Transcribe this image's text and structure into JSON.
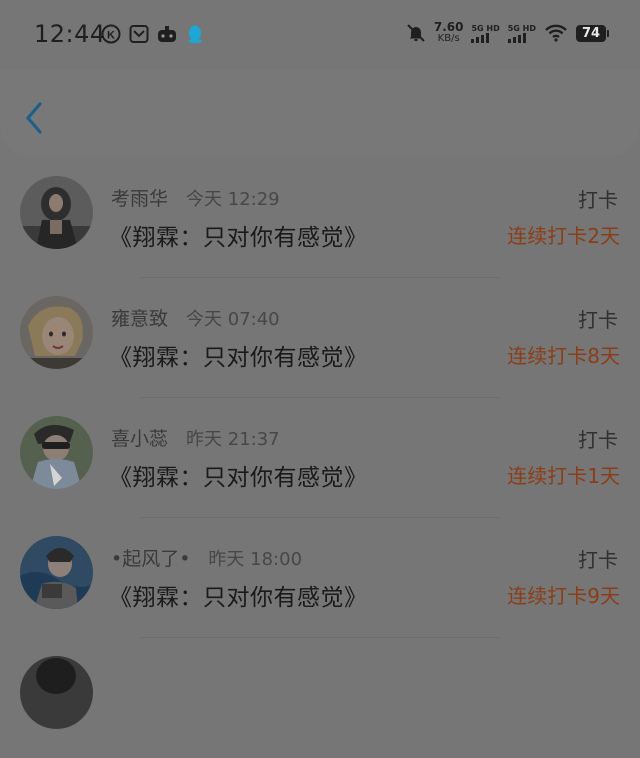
{
  "status_bar": {
    "time": "12:44",
    "left_icons": [
      "k-circle-icon",
      "app-badge-icon",
      "game-icon",
      "qq-penguin-icon"
    ],
    "net_speed": "7.60",
    "net_unit": "KB/s",
    "signal_1_label": "5G HD",
    "signal_2_label": "5G HD",
    "battery": "74",
    "icons": [
      "mute-bell-icon",
      "signal-icon",
      "signal-icon",
      "wifi-icon",
      "battery-icon"
    ]
  },
  "nav": {
    "back_icon": "chevron-left-icon"
  },
  "colors": {
    "accent": "#1e5f8a",
    "streak": "#8a3d18",
    "overlay": "#767676"
  },
  "checkins": [
    {
      "user": "考雨华",
      "time": "今天 12:29",
      "song": "《翔霖：只对你有感觉》",
      "tag": "打卡",
      "streak": "连续打卡2天"
    },
    {
      "user": "雍意致",
      "time": "今天 07:40",
      "song": "《翔霖：只对你有感觉》",
      "tag": "打卡",
      "streak": "连续打卡8天"
    },
    {
      "user": "喜小蕊",
      "time": "昨天 21:37",
      "song": "《翔霖：只对你有感觉》",
      "tag": "打卡",
      "streak": "连续打卡1天"
    },
    {
      "user": "•起风了•",
      "time": "昨天 18:00",
      "song": "《翔霖：只对你有感觉》",
      "tag": "打卡",
      "streak": "连续打卡9天"
    }
  ]
}
